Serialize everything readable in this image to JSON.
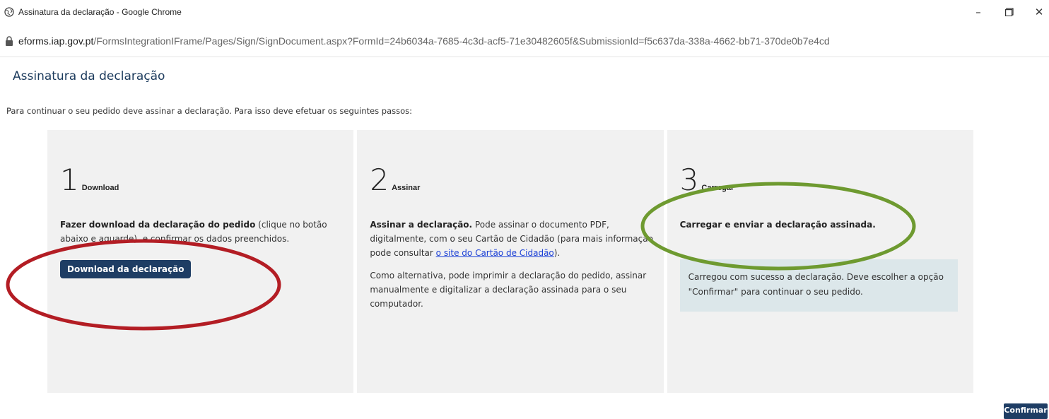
{
  "window": {
    "title": "Assinatura da declaração - Google Chrome",
    "minimize_icon": "minimize-icon",
    "maximize_icon": "maximize-icon",
    "close_icon": "close-icon"
  },
  "address": {
    "host": "eforms.iap.gov.pt",
    "path": "/FormsIntegrationIFrame/Pages/Sign/SignDocument.aspx?FormId=24b6034a-7685-4c3d-acf5-71e30482605f&SubmissionId=f5c637da-338a-4662-bb71-370de0b7e4cd"
  },
  "page": {
    "title": "Assinatura da declaração",
    "intro": "Para continuar o seu pedido deve assinar a declaração. Para isso deve efetuar os seguintes passos:"
  },
  "steps": [
    {
      "number": "1",
      "name": "Download",
      "text_bold": "Fazer download da declaração do pedido",
      "text_rest": " (clique no botão abaixo e aguarde), e confirmar os dados preenchidos.",
      "button": "Download da declaração"
    },
    {
      "number": "2",
      "name": "Assinar",
      "text_bold": "Assinar a declaração.",
      "text_rest": " Pode assinar o documento PDF, digitalmente, com o seu Cartão de Cidadão (para mais informação pode consultar ",
      "link": "o site do Cartão de Cidadão",
      "text_after_link": ").",
      "alt_text": "Como alternativa, pode imprimir a declaração do pedido, assinar manualmente e digitalizar a declaração assinada para o seu computador."
    },
    {
      "number": "3",
      "name": "Carregar",
      "text_bold": "Carregar e enviar a declaração assinada.",
      "success": "Carregou com sucesso a declaração. Deve escolher a opção \"Confirmar\" para continuar o seu pedido."
    }
  ],
  "confirm_button": "Confirmar",
  "colors": {
    "accent": "#1e3d64",
    "panel": "#f1f1f1",
    "success_bg": "#dce7ea",
    "annotation_red": "#b31d24",
    "annotation_green": "#6e9a30"
  }
}
